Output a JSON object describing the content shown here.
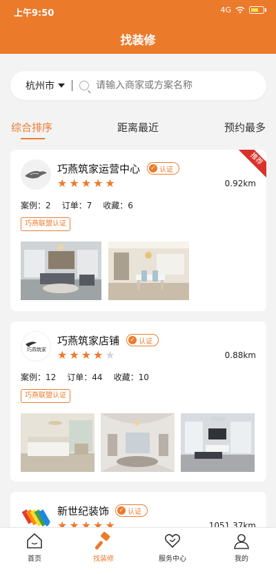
{
  "status_bar": {
    "time": "上午9:50",
    "signal": "4G"
  },
  "header": {
    "title": "找装修"
  },
  "search": {
    "city": "杭州市",
    "placeholder": "请输入商家或方案名称"
  },
  "tabs": [
    {
      "label": "综合排序",
      "active": true
    },
    {
      "label": "距离最近",
      "active": false
    },
    {
      "label": "预约最多",
      "active": false
    }
  ],
  "shops": [
    {
      "name": "巧燕筑家运营中心",
      "cert": "认证",
      "rating": 5,
      "distance": "0.92km",
      "cases_label": "案例：2",
      "orders_label": "订单：7",
      "favorites_label": "收藏：6",
      "alliance": "巧燕联盟认证",
      "ribbon": "推荐",
      "photo_count": 2
    },
    {
      "name": "巧燕筑家店铺",
      "cert": "认证",
      "rating": 4,
      "distance": "0.88km",
      "cases_label": "案例：12",
      "orders_label": "订单：44",
      "favorites_label": "收藏：10",
      "alliance": "巧燕联盟认证",
      "logo_text": "巧燕筑家",
      "photo_count": 3
    },
    {
      "name": "新世纪装饰",
      "cert": "认证",
      "rating": 5,
      "distance": "1051.37km"
    }
  ],
  "bottom_nav": [
    {
      "label": "首页",
      "icon": "home-icon",
      "active": false
    },
    {
      "label": "找装修",
      "icon": "hammer-icon",
      "active": true
    },
    {
      "label": "服务中心",
      "icon": "heart-service-icon",
      "active": false
    },
    {
      "label": "我的",
      "icon": "user-icon",
      "active": false
    }
  ],
  "colors": {
    "accent": "#ec7a2b",
    "ribbon": "#d9322b",
    "background": "#f3f3f3"
  }
}
